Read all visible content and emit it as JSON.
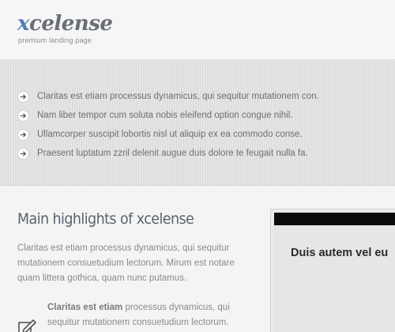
{
  "header": {
    "logo_prefix": "x",
    "logo_rest": "celense",
    "tagline": "premium landing page"
  },
  "features": {
    "items": [
      "Claritas est etiam processus dynamicus, qui sequitur mutationem con.",
      "Nam liber tempor cum soluta nobis eleifend option congue nihil.",
      "Ullamcorper suscipit lobortis nisl ut aliquip ex ea commodo conse.",
      "Praesent luptatum zzril delenit augue duis dolore te feugait nulla fa."
    ],
    "bullet_icon": "arrow-right-icon"
  },
  "main": {
    "title": "Main highlights of xcelense",
    "text": "Claritas est etiam processus dynamicus, qui sequitur mutationem consuetudium lectorum. Mirum est notare quam littera gothica, quam nunc putamus.",
    "highlight": {
      "icon": "pencil-icon",
      "bold": "Claritas est etiam",
      "text": " processus dynamicus, qui sequitur mutationem consuetudium lectorum."
    }
  },
  "panel": {
    "title": "Duis autem vel eu"
  },
  "colors": {
    "logo_accent": "#4f7db5",
    "logo_text": "#6a6f76",
    "band_bg": "#e2e2e2",
    "panel_bar": "#0b0b0b"
  }
}
